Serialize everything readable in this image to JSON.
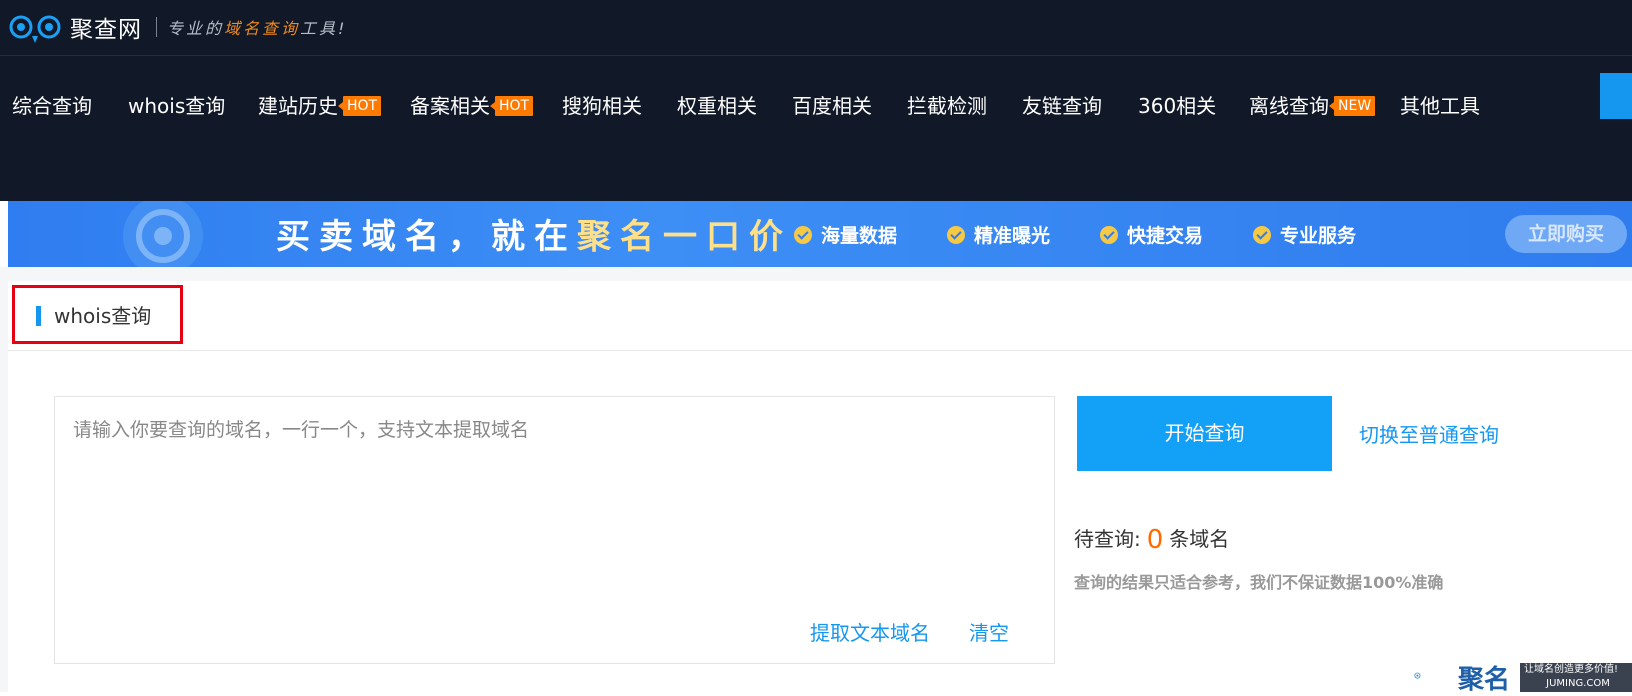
{
  "header": {
    "logo_name": "聚查网",
    "slogan_prefix": "专业的",
    "slogan_highlight": "域名查询",
    "slogan_suffix": "工具!"
  },
  "nav": {
    "items": [
      {
        "label": "综合查询",
        "badge": ""
      },
      {
        "label": "whois查询",
        "badge": ""
      },
      {
        "label": "建站历史",
        "badge": "HOT"
      },
      {
        "label": "备案相关",
        "badge": "HOT"
      },
      {
        "label": "搜狗相关",
        "badge": ""
      },
      {
        "label": "权重相关",
        "badge": ""
      },
      {
        "label": "百度相关",
        "badge": ""
      },
      {
        "label": "拦截检测",
        "badge": ""
      },
      {
        "label": "友链查询",
        "badge": ""
      },
      {
        "label": "360相关",
        "badge": ""
      },
      {
        "label": "离线查询",
        "badge": "NEW"
      },
      {
        "label": "其他工具",
        "badge": ""
      }
    ]
  },
  "banner": {
    "title_part1": "买卖域名，就在",
    "title_part2": "聚名一口价",
    "features": [
      "海量数据",
      "精准曝光",
      "快捷交易",
      "专业服务"
    ],
    "buy_label": "立即购买"
  },
  "section": {
    "title": "whois查询"
  },
  "query": {
    "placeholder": "请输入你要查询的域名，一行一个，支持文本提取域名",
    "value": "",
    "extract_label": "提取文本域名",
    "clear_label": "清空",
    "start_label": "开始查询",
    "switch_label": "切换至普通查询",
    "pending_prefix": "待查询:",
    "pending_count": "0",
    "pending_suffix": "条域名",
    "disclaimer": "查询的结果只适合参考，我们不保证数据100%准确"
  },
  "watermark": {
    "name": "聚名",
    "slogan": "让域名创造更多价值!",
    "url": "JUMING.COM"
  },
  "colors": {
    "header_bg": "#111827",
    "accent": "#1597f0",
    "badge": "#ff7a00",
    "highlight_box": "#e60012"
  }
}
